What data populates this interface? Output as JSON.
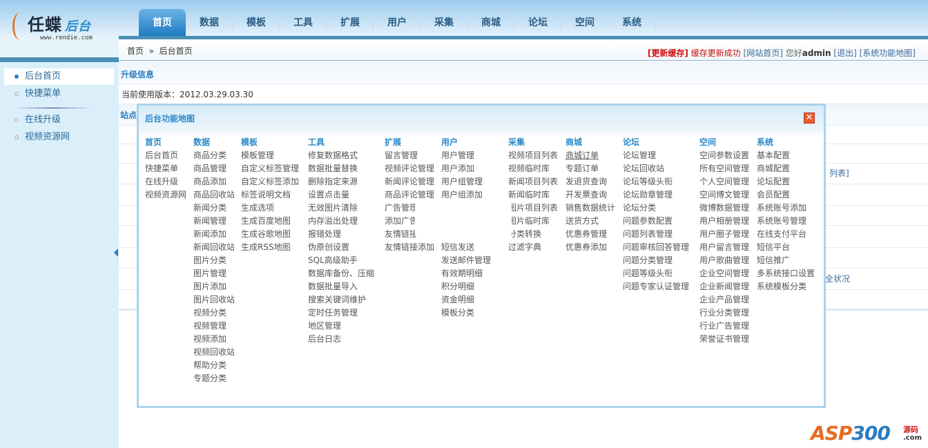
{
  "logo": {
    "name": "任蝶",
    "suffix": "后台",
    "url": "www.rendie.com"
  },
  "tabs": [
    "首页",
    "数据",
    "模板",
    "工具",
    "扩展",
    "用户",
    "采集",
    "商城",
    "论坛",
    "空间",
    "系统"
  ],
  "breadcrumb": {
    "home": "首页",
    "sep": "»",
    "current": "后台首页"
  },
  "topbar": {
    "update_cache": "[更新缓存]",
    "cache_msg": "缓存更新成功",
    "site_home": "[网站首页]",
    "greeting": "您好",
    "user": "admin",
    "logout": "[退出]",
    "sitemap": "[系统功能地图]"
  },
  "sidebar": {
    "items": [
      "后台首页",
      "快捷菜单"
    ],
    "items2": [
      "在线升级",
      "视频资源网"
    ]
  },
  "main": {
    "section_title": "升级信息",
    "version": "当前使用版本：2012.03.29.03.30",
    "site_label": "站点",
    "frag1": "列表]",
    "frag2": "全状况"
  },
  "modal": {
    "title": "后台功能地图",
    "columns": [
      {
        "h": "首页",
        "items": [
          "后台首页",
          "快捷菜单",
          "在线升级",
          "视频资源网"
        ]
      },
      {
        "h": "数据",
        "items": [
          "商品分类",
          "商品管理",
          "商品添加",
          "商品回收站",
          "新闻分类",
          "新闻管理",
          "新闻添加",
          "新闻回收站",
          "图片分类",
          "图片管理",
          "图片添加",
          "图片回收站",
          "视频分类",
          "视频管理",
          "视频添加",
          "视频回收站",
          "帮助分类",
          "专题分类"
        ]
      },
      {
        "h": "模板",
        "items": [
          "模板管理",
          "自定义标签管理",
          "自定义标签添加",
          "标签说明文档",
          "生成选项",
          "生成百度地图",
          "生成谷歌地图",
          "生成RSS地图"
        ]
      },
      {
        "h": "工具",
        "items": [
          "修复数据格式",
          "数据批量替换",
          "删除指定来源",
          "设置点击量",
          "无效图片清除",
          "内存溢出处理",
          "报错处理",
          "伪原创设置",
          "SQL高级助手",
          "数据库备份、压缩",
          "数据批量导入",
          "搜索关键词维护",
          "定时任务管理",
          "地区管理",
          "后台日志"
        ]
      },
      {
        "h": "扩展",
        "items": [
          "留言管理",
          "视频评论管理",
          "新闻评论管理",
          "商品评论管理",
          "广告管理",
          "添加广告",
          "友情链接",
          "友情链接添加"
        ]
      },
      {
        "h": "用户",
        "items": [
          "用户管理",
          "用户添加",
          "用户组管理",
          "用户组添加",
          "",
          "",
          "",
          "短信发送",
          "发送邮件管理",
          "有效期明细",
          "积分明细",
          "资金明细",
          "模板分类"
        ]
      },
      {
        "h": "采集",
        "items": [
          "视频项目列表",
          "视频临时库",
          "新闻项目列表",
          "新闻临时库",
          "图片项目列表",
          "图片临时库",
          "分类转换",
          "过滤字典"
        ]
      },
      {
        "h": "商城",
        "items": [
          "商城订单",
          "专题订单",
          "发退货查询",
          "开发票查询",
          "销售数据统计",
          "送货方式",
          "优惠券管理",
          "优惠券添加"
        ]
      },
      {
        "h": "论坛",
        "items": [
          "论坛管理",
          "论坛回收站",
          "论坛等级头衔",
          "论坛勋章管理",
          "论坛分类",
          "问题参数配置",
          "问题列表管理",
          "问题审核回答管理",
          "问题分类管理",
          "问题等级头衔",
          "问题专家认证管理"
        ]
      },
      {
        "h": "空间",
        "items": [
          "空间参数设置",
          "所有空间管理",
          "个人空间管理",
          "空间博文管理",
          "微博数据管理",
          "用户相册管理",
          "用户圈子管理",
          "用户留言管理",
          "用户歌曲管理",
          "企业空间管理",
          "企业新闻管理",
          "企业产品管理",
          "行业分类管理",
          "行业广告管理",
          "荣誉证书管理"
        ]
      },
      {
        "h": "系统",
        "items": [
          "基本配置",
          "商城配置",
          "论坛配置",
          "会员配置",
          "系统账号添加",
          "系统账号管理",
          "在线支付平台",
          "短信平台",
          "短信推广",
          "多系统接口设置",
          "系统模板分类"
        ]
      }
    ]
  },
  "watermark": {
    "brand": "ASP300",
    "sub": "源码",
    "tld": ".com"
  }
}
